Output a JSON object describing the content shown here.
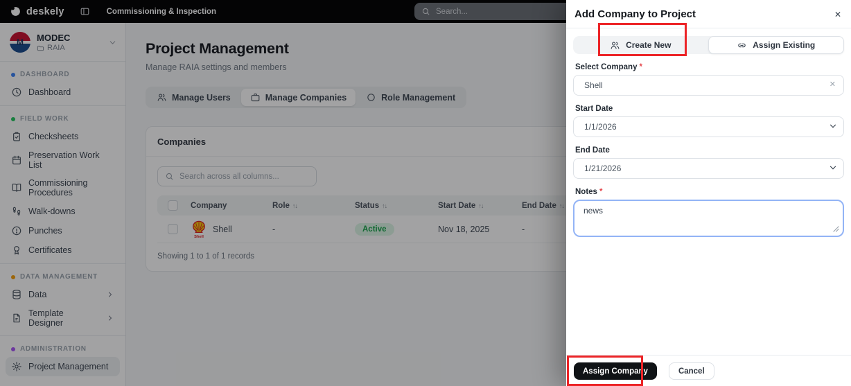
{
  "topbar": {
    "brand": "deskely",
    "app_title": "Commissioning & Inspection",
    "search_placeholder": "Search..."
  },
  "sidebar": {
    "org": {
      "name": "MODEC",
      "project": "RAIA",
      "logo_letter": "M"
    },
    "sections": [
      {
        "label": "DASHBOARD",
        "items": [
          {
            "label": "Dashboard"
          }
        ]
      },
      {
        "label": "FIELD WORK",
        "items": [
          {
            "label": "Checksheets"
          },
          {
            "label": "Preservation Work List"
          },
          {
            "label": "Commissioning Procedures"
          },
          {
            "label": "Walk-downs"
          },
          {
            "label": "Punches"
          },
          {
            "label": "Certificates"
          }
        ]
      },
      {
        "label": "DATA MANAGEMENT",
        "items": [
          {
            "label": "Data"
          },
          {
            "label": "Template Designer"
          }
        ]
      },
      {
        "label": "ADMINISTRATION",
        "items": [
          {
            "label": "Project Management"
          }
        ]
      }
    ]
  },
  "main": {
    "title": "Project Management",
    "subtitle": "Manage RAIA settings and members",
    "tabs": [
      {
        "label": "Manage Users"
      },
      {
        "label": "Manage Companies"
      },
      {
        "label": "Role Management"
      }
    ],
    "card": {
      "title": "Companies",
      "search_placeholder": "Search across all columns...",
      "columns": {
        "company": "Company",
        "role": "Role",
        "status": "Status",
        "start": "Start Date",
        "end": "End Date"
      },
      "sort_glyph": "↑↓",
      "rows": [
        {
          "company": "Shell",
          "role": "-",
          "status": "Active",
          "start": "Nov 18, 2025",
          "end": "-"
        }
      ],
      "footer": "Showing 1 to 1 of 1 records"
    }
  },
  "modal": {
    "title": "Add Company to Project",
    "close_glyph": "✕",
    "segments": [
      {
        "label": "Create New"
      },
      {
        "label": "Assign Existing"
      }
    ],
    "fields": {
      "company": {
        "label": "Select Company",
        "required_mark": "*",
        "value": "Shell",
        "clear_glyph": "✕"
      },
      "start_date": {
        "label": "Start Date",
        "value": "1/1/2026"
      },
      "end_date": {
        "label": "End Date",
        "value": "1/21/2026"
      },
      "notes": {
        "label": "Notes",
        "required_mark": "*",
        "value": "news"
      }
    },
    "buttons": {
      "assign": "Assign Company",
      "cancel": "Cancel"
    }
  },
  "colors": {
    "annotation_red": "#ec2427",
    "topbar_bg": "#000000",
    "active_badge_text": "#17a34a",
    "active_badge_bg": "#dcf5e5",
    "notes_focus_border": "#93b4f6",
    "section_dots": {
      "dashboard": "#3b82f6",
      "field_work": "#22c55e",
      "data_management": "#f59e0b",
      "administration": "#a855f7"
    },
    "shell_logo": {
      "yellow": "#FBCE07",
      "red": "#DD1D21"
    },
    "modec_logo": {
      "red": "#c8102e",
      "blue": "#174a8c"
    }
  }
}
